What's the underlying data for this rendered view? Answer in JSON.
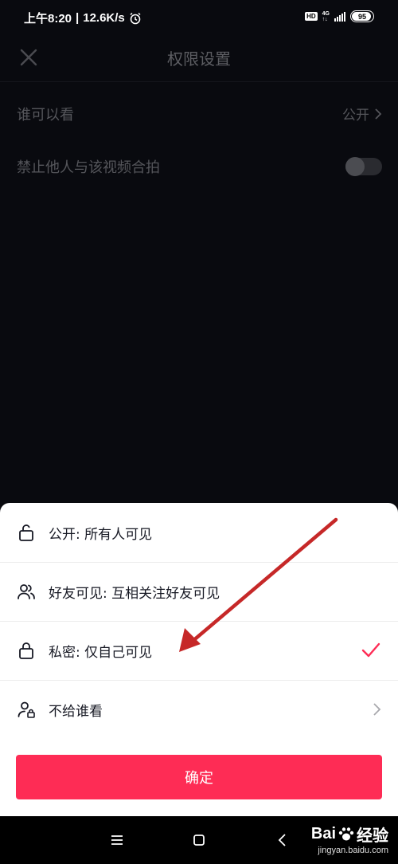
{
  "status": {
    "time": "上午8:20",
    "speed": "12.6K/s",
    "hd": "HD",
    "network": "4G",
    "battery": "95"
  },
  "header": {
    "title": "权限设置"
  },
  "settings": {
    "visibility_label": "谁可以看",
    "visibility_value": "公开",
    "duet_label": "禁止他人与该视频合拍"
  },
  "sheet": {
    "options": [
      {
        "label": "公开: 所有人可见"
      },
      {
        "label": "好友可见: 互相关注好友可见"
      },
      {
        "label": "私密: 仅自己可见"
      },
      {
        "label": "不给谁看"
      }
    ],
    "confirm_label": "确定"
  },
  "watermark": {
    "brand": "Bai",
    "brand_suffix": "经验",
    "url": "jingyan.baidu.com"
  },
  "colors": {
    "accent": "#fe2c55",
    "background": "#090a0f",
    "annotation_arrow": "#c62828"
  }
}
